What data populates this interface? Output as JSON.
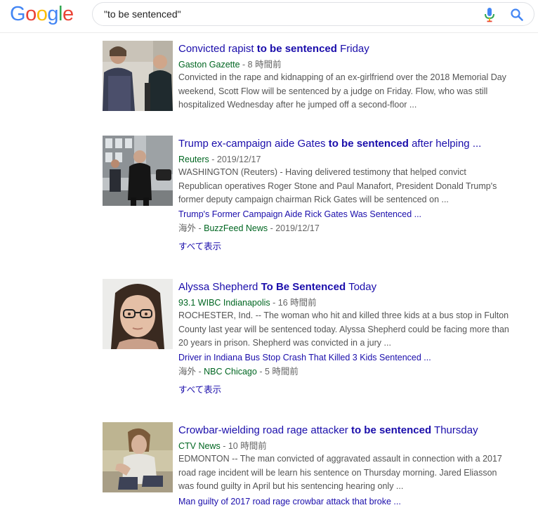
{
  "header": {
    "logo_letters": [
      {
        "ch": "G",
        "color": "#4285f4"
      },
      {
        "ch": "o",
        "color": "#ea4335"
      },
      {
        "ch": "o",
        "color": "#fbbc05"
      },
      {
        "ch": "g",
        "color": "#4285f4"
      },
      {
        "ch": "l",
        "color": "#34a853"
      },
      {
        "ch": "e",
        "color": "#ea4335"
      }
    ],
    "search_query": "\"to be sentenced\"",
    "accent_color": "#4285f4"
  },
  "results": [
    {
      "title_pre": "Convicted rapist ",
      "title_bold": "to be sentenced",
      "title_post": " Friday",
      "site": "Gaston Gazette",
      "time": " - 8 時間前",
      "snippet": [
        "Convicted in the rape and kidnapping of an ex-girlfriend over the 2018 Memorial Day",
        "weekend, Scott Flow will be sentenced by a judge on Friday. Flow, who was still",
        "hospitalized Wednesday after he jumped off a second-floor ..."
      ]
    },
    {
      "title_pre": "Trump ex-campaign aide Gates ",
      "title_bold": "to be sentenced",
      "title_post": " after helping ...",
      "site": "Reuters",
      "time": " - 2019/12/17",
      "snippet": [
        "WASHINGTON (Reuters) - Having delivered testimony that helped convict",
        "Republican operatives Roger Stone and Paul Manafort, President Donald Trump's",
        "former deputy campaign chairman Rick Gates will be sentenced on ..."
      ],
      "related_title": "Trump's Former Campaign Aide Rick Gates Was Sentenced ...",
      "related_prefix": "海外 - ",
      "related_site": "BuzzFeed News",
      "related_time": " - 2019/12/17",
      "show_all": "すべて表示"
    },
    {
      "title_pre": "Alyssa Shepherd ",
      "title_bold": "To Be Sentenced",
      "title_post": " Today",
      "site": "93.1 WIBC Indianapolis",
      "time": " - 16 時間前",
      "snippet": [
        "ROCHESTER, Ind. -- The woman who hit and killed three kids at a bus stop in Fulton",
        "County last year will be sentenced today. Alyssa Shepherd could be facing more than",
        "20 years in prison. Shepherd was convicted in a jury ..."
      ],
      "related_title": "Driver in Indiana Bus Stop Crash That Killed 3 Kids Sentenced ...",
      "related_prefix": "海外 - ",
      "related_site": "NBC Chicago",
      "related_time": " - 5 時間前",
      "show_all": "すべて表示"
    },
    {
      "title_pre": "Crowbar-wielding road rage attacker ",
      "title_bold": "to be sentenced",
      "title_post": " Thursday",
      "site": "CTV News",
      "time": " - 10 時間前",
      "snippet": [
        "EDMONTON -- The man convicted of aggravated assault in connection with a 2017",
        "road rage incident will be learn his sentence on Thursday morning. Jared Eliasson",
        "was found guilty in April but his sentencing hearing only ..."
      ],
      "related_title": "Man guilty of 2017 road rage crowbar attack that broke ..."
    }
  ]
}
